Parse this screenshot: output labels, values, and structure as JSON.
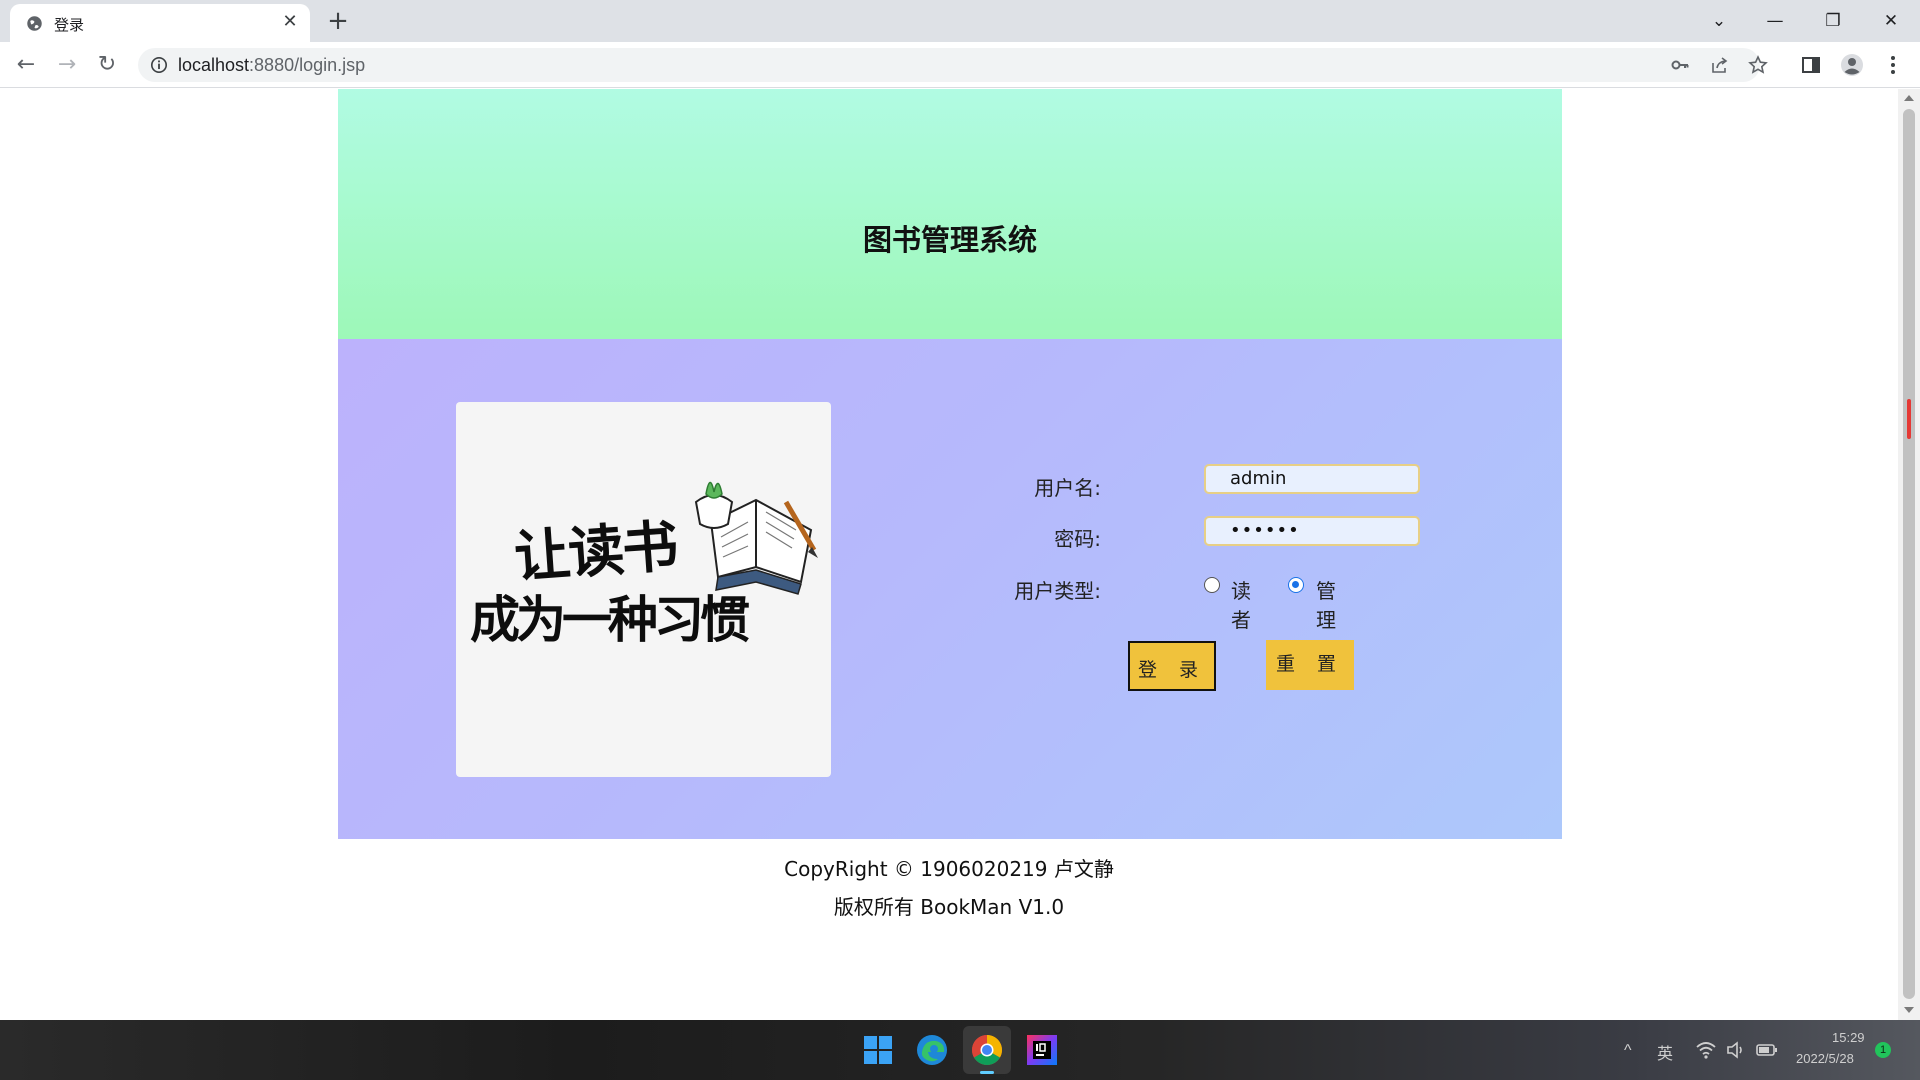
{
  "browser": {
    "tab_title": "登录",
    "tab_close": "✕",
    "new_tab": "+",
    "url_host": "localhost",
    "url_rest": ":8880/login.jsp",
    "window_controls": {
      "tab_search": "⌄",
      "minimize": "—",
      "restore": "❐",
      "close": "✕"
    },
    "nav": {
      "back": "←",
      "forward": "→",
      "reload": "↻"
    },
    "icons": [
      "key-icon",
      "share-icon",
      "star-icon",
      "sidebar-icon",
      "profile-icon",
      "menu-icon"
    ]
  },
  "page": {
    "site_title": "图书管理系统",
    "form": {
      "username_label": "用户名:",
      "username_value": "admin",
      "password_label": "密码:",
      "password_value": "••••••",
      "user_type_label": "用户类型:",
      "user_types": [
        {
          "label": "读者",
          "checked": false
        },
        {
          "label": "管理员",
          "checked": true
        }
      ],
      "login_button": "登 录",
      "reset_button": "重 置"
    },
    "poster": {
      "line1": "让读书",
      "line2": "成为一种习惯"
    },
    "footer": {
      "copyright": "CopyRight © 1906020219 卢文静",
      "rights": "版权所有 BookMan V1.0"
    }
  },
  "taskbar": {
    "apps": [
      "windows-start-icon",
      "edge-icon",
      "chrome-icon",
      "intellij-icon"
    ],
    "tray": {
      "chevron": "^",
      "ime": "英",
      "time": "15:29",
      "date": "2022/5/28",
      "notification_count": "1"
    }
  },
  "colors": {
    "header_top": "#b1fbe3",
    "header_bottom": "#9df8b8",
    "main_left": "#bcb2fc",
    "main_right": "#adc8fb",
    "button": "#f0c23c",
    "input_fill": "#e8f0fe",
    "input_border": "#e7cf86"
  }
}
